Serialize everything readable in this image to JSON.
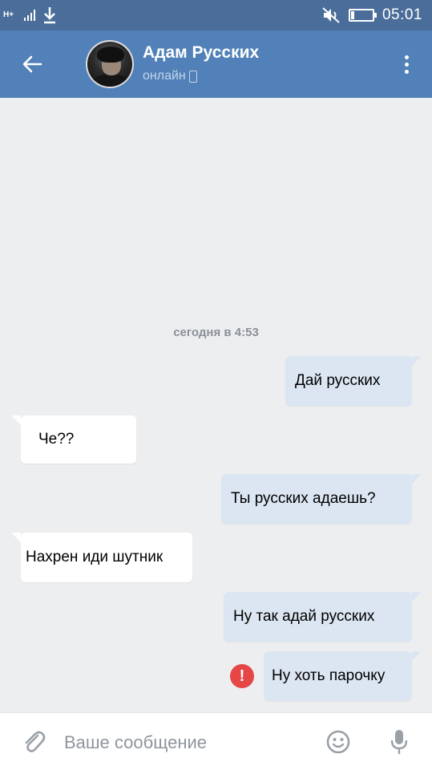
{
  "status_bar": {
    "network": "H+",
    "time": "05:01",
    "icons": [
      "signal-icon",
      "download-icon",
      "mute-vibrate-icon",
      "battery-icon"
    ]
  },
  "header": {
    "contact_name": "Адам Русских",
    "status": "онлайн",
    "icons": [
      "back-arrow-icon",
      "mobile-phone-icon",
      "more-vert-icon"
    ]
  },
  "chat": {
    "date_separator": "сегодня в 4:53",
    "messages": [
      {
        "direction": "out",
        "text": "Дай русских"
      },
      {
        "direction": "in",
        "text": "Че??"
      },
      {
        "direction": "out",
        "text": "Ты русских адаешь?"
      },
      {
        "direction": "in",
        "text": "Нахрен иди шутник"
      },
      {
        "direction": "out",
        "text": "Ну так адай русских"
      },
      {
        "direction": "out",
        "text": "Ну хоть парочку",
        "error": true
      }
    ],
    "error_icon_glyph": "!"
  },
  "input_bar": {
    "placeholder": "Ваше сообщение",
    "value": "",
    "icons": [
      "paperclip-icon",
      "emoji-icon",
      "microphone-icon"
    ]
  },
  "colors": {
    "status_bar": "#4a6e99",
    "header": "#5181b8",
    "chat_background": "#edeef0",
    "outgoing_bubble": "#dce6f2",
    "incoming_bubble": "#ffffff",
    "error": "#e64646"
  }
}
